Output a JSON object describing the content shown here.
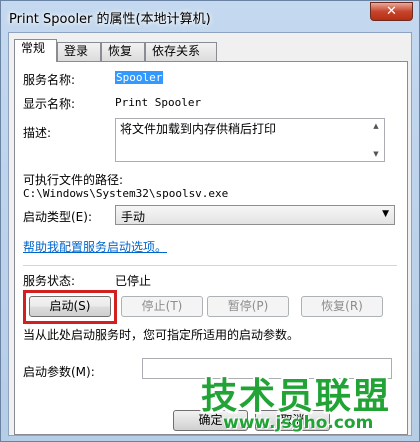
{
  "window": {
    "title": "Print Spooler 的属性(本地计算机)",
    "close_glyph": "✕"
  },
  "tabs": [
    {
      "label": "常规",
      "active": true
    },
    {
      "label": "登录",
      "active": false
    },
    {
      "label": "恢复",
      "active": false
    },
    {
      "label": "依存关系",
      "active": false
    }
  ],
  "general": {
    "service_name_label": "服务名称:",
    "service_name": "Spooler",
    "display_name_label": "显示名称:",
    "display_name": "Print Spooler",
    "description_label": "描述:",
    "description": "将文件加载到内存供稍后打印",
    "exe_path_label": "可执行文件的路径:",
    "exe_path": "C:\\Windows\\System32\\spoolsv.exe",
    "startup_type_label": "启动类型(E):",
    "startup_type": "手动",
    "help_link": "帮助我配置服务启动选项。",
    "status_label": "服务状态:",
    "status_value": "已停止",
    "buttons": {
      "start": "启动(S)",
      "stop": "停止(T)",
      "pause": "暂停(P)",
      "resume": "恢复(R)"
    },
    "hint": "当从此处启动服务时，您可指定所适用的启动参数。",
    "param_label": "启动参数(M):",
    "param_value": ""
  },
  "footer": {
    "ok": "确定",
    "cancel": "取消"
  },
  "watermark": {
    "text": "技术员联盟",
    "url": "www.jsgho.com"
  },
  "colors": {
    "highlight": "#d21f1f",
    "watermark": "#21a336",
    "link": "#0066cc"
  }
}
